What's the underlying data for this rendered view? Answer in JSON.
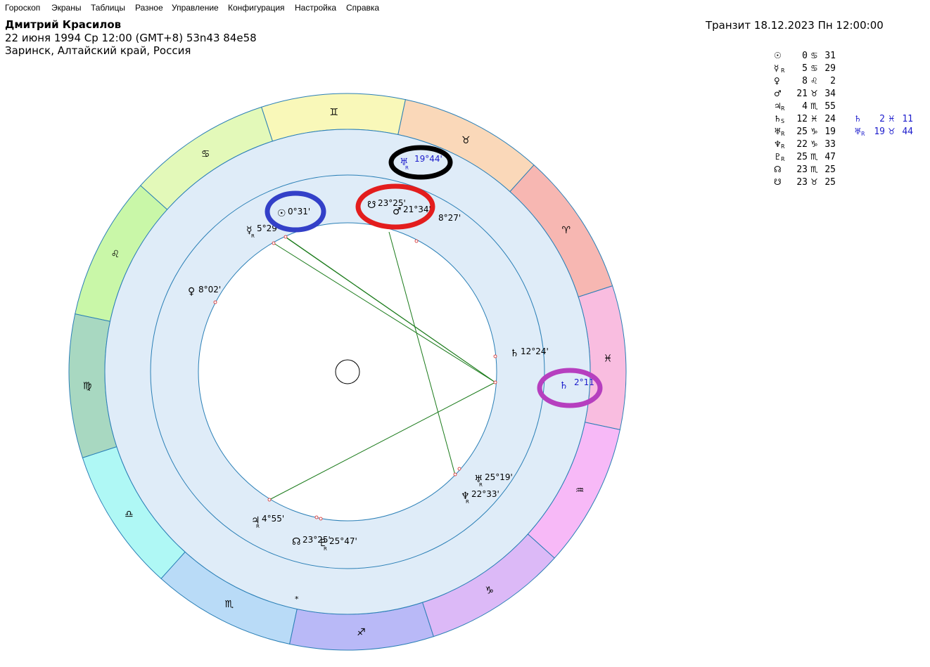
{
  "menu": [
    "Гороскоп",
    "Экраны",
    "Таблицы",
    "Разное",
    "Управление",
    "Конфигурация",
    "Настройка",
    "Справка"
  ],
  "header": {
    "name": "Дмитрий Красилов",
    "birth_line": "22 июня 1994  Ср  12:00 (GMT+8) 53n43  84e58",
    "place": "Заринск, Алтайский край, Россия",
    "transit": "Транзит 18.12.2023  Пн 12:00:00"
  },
  "colors": {
    "ring_bg": "#dfecf8",
    "ring_border": "#2a7fb6",
    "aspect": "#1a7a1a",
    "natal_text": "#000000",
    "transit_text": "#1d1dcc",
    "highlight_black": "#000000",
    "highlight_red": "#e31d1d",
    "highlight_blue": "#3340c8",
    "highlight_purple": "#b63fbf"
  },
  "zodiac": [
    {
      "sign": "pisces",
      "glyph": "♓",
      "color": "#f9bde0"
    },
    {
      "sign": "aries",
      "glyph": "♈",
      "color": "#f7b7b2"
    },
    {
      "sign": "taurus",
      "glyph": "♉",
      "color": "#fad8b9"
    },
    {
      "sign": "gemini",
      "glyph": "♊",
      "color": "#f9f8b9"
    },
    {
      "sign": "cancer",
      "glyph": "♋",
      "color": "#e3f9b9"
    },
    {
      "sign": "leo",
      "glyph": "♌",
      "color": "#c9f7a8"
    },
    {
      "sign": "virgo",
      "glyph": "♍",
      "color": "#a8d8c1"
    },
    {
      "sign": "libra",
      "glyph": "♎",
      "color": "#aff8f5"
    },
    {
      "sign": "scorpio",
      "glyph": "♏",
      "color": "#b9dbf7"
    },
    {
      "sign": "sagittarius",
      "glyph": "♐",
      "color": "#b9b9f7"
    },
    {
      "sign": "capricorn",
      "glyph": "♑",
      "color": "#dcb9f7"
    },
    {
      "sign": "aquarius",
      "glyph": "♒",
      "color": "#f7b9f7"
    }
  ],
  "table": [
    {
      "glyph": "☉",
      "retro": "",
      "deg": "0",
      "sign": "♋",
      "min": "31"
    },
    {
      "glyph": "☿",
      "retro": "R",
      "deg": "5",
      "sign": "♋",
      "min": "29"
    },
    {
      "glyph": "♀",
      "retro": "",
      "deg": "8",
      "sign": "♌",
      "min": "2"
    },
    {
      "glyph": "♂",
      "retro": "",
      "deg": "21",
      "sign": "♉",
      "min": "34"
    },
    {
      "glyph": "♃",
      "retro": "R",
      "deg": "4",
      "sign": "♏",
      "min": "55"
    },
    {
      "glyph": "♄",
      "retro": "S",
      "deg": "12",
      "sign": "♓",
      "min": "24",
      "t_glyph": "♄",
      "t_retro": "",
      "t_deg": "2",
      "t_sign": "♓",
      "t_min": "11"
    },
    {
      "glyph": "♅",
      "retro": "R",
      "deg": "25",
      "sign": "♑",
      "min": "19",
      "t_glyph": "♅",
      "t_retro": "R",
      "t_deg": "19",
      "t_sign": "♉",
      "t_min": "44"
    },
    {
      "glyph": "♆",
      "retro": "R",
      "deg": "22",
      "sign": "♑",
      "min": "33"
    },
    {
      "glyph": "♇",
      "retro": "R",
      "deg": "25",
      "sign": "♏",
      "min": "47"
    },
    {
      "glyph": "☊",
      "retro": "",
      "deg": "23",
      "sign": "♏",
      "min": "25"
    },
    {
      "glyph": "☋",
      "retro": "",
      "deg": "23",
      "sign": "♉",
      "min": "25"
    }
  ],
  "natal_labels": [
    {
      "name": "uranus",
      "glyph": "♅",
      "retro": "R",
      "text": "25°19'"
    },
    {
      "name": "neptune",
      "glyph": "♆",
      "retro": "R",
      "text": "22°33'"
    },
    {
      "name": "jupiter",
      "glyph": "♃",
      "retro": "R",
      "text": "4°55'"
    },
    {
      "name": "north-node",
      "glyph": "☊",
      "retro": "",
      "text": "23°25'"
    },
    {
      "name": "pluto",
      "glyph": "♇",
      "retro": "R",
      "text": "25°47'"
    },
    {
      "name": "venus",
      "glyph": "♀",
      "retro": "",
      "text": "8°02'"
    },
    {
      "name": "mercury",
      "glyph": "☿",
      "retro": "R",
      "text": "5°29'"
    },
    {
      "name": "sun",
      "glyph": "☉",
      "retro": "",
      "text": "0°31'"
    },
    {
      "name": "south-node",
      "glyph": "☋",
      "retro": "",
      "text": "23°25'"
    },
    {
      "name": "mars",
      "glyph": "♂",
      "retro": "",
      "text": "21°34'"
    },
    {
      "name": "asc",
      "glyph": "",
      "retro": "",
      "text": "8°27'"
    },
    {
      "name": "saturn",
      "glyph": "♄",
      "retro": "",
      "text": "12°24'"
    }
  ],
  "transit_labels": [
    {
      "name": "uranus",
      "glyph": "♅",
      "retro": "R",
      "text": "19°44'"
    },
    {
      "name": "saturn",
      "glyph": "♄",
      "retro": "",
      "text": "2°11'"
    }
  ],
  "house_marker": "*"
}
